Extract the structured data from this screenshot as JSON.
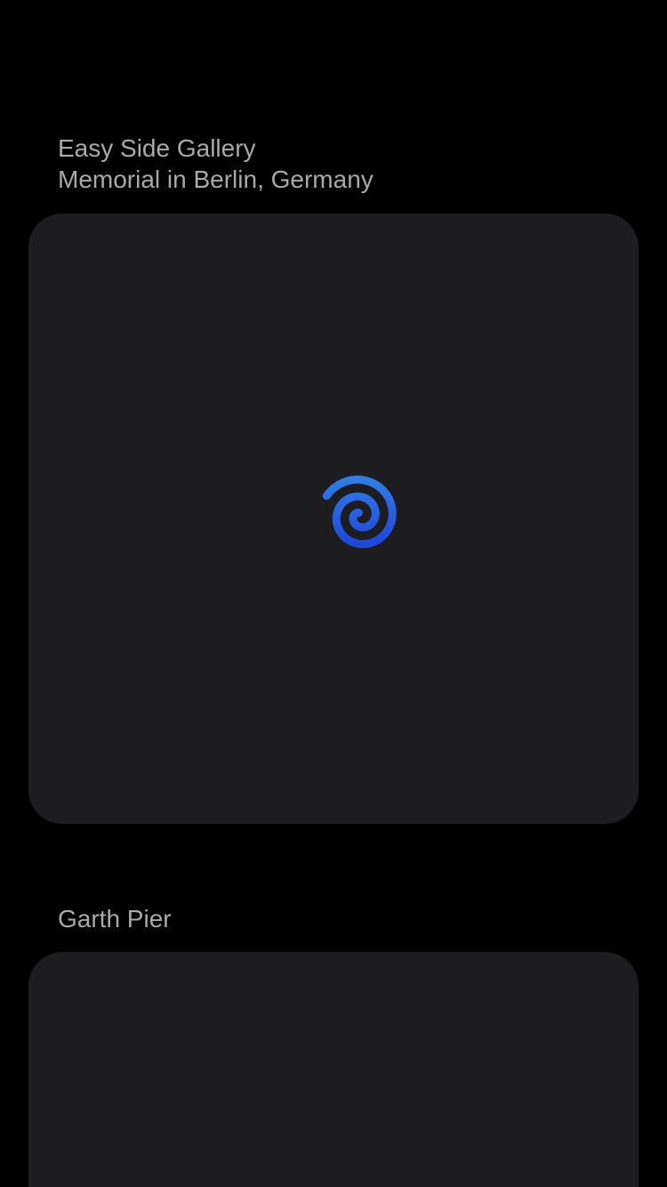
{
  "cards": [
    {
      "title_line1": "Easy Side Gallery",
      "title_line2": "Memorial in Berlin, Germany",
      "loading_icon": "spiral-loading-icon"
    },
    {
      "title_line1": "Garth Pier"
    }
  ],
  "colors": {
    "background": "#000000",
    "card": "#1d1d1f",
    "title_text": "#a9a9ab",
    "spinner_light": "#2f7ce6",
    "spinner_dark": "#1e47dc"
  }
}
